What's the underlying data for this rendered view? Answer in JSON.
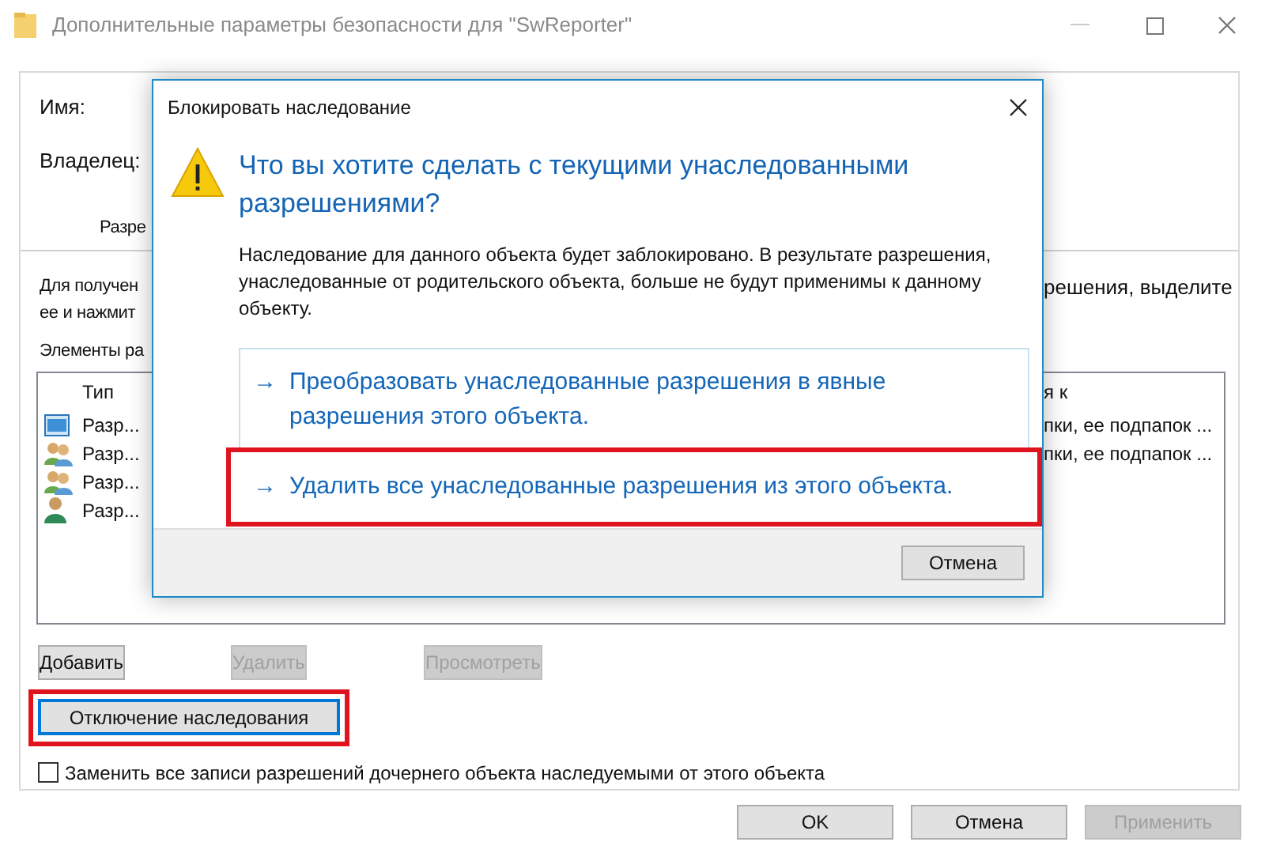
{
  "window": {
    "title": "Дополнительные параметры безопасности  для \"SwReporter\""
  },
  "fields": [
    {
      "label": "Имя:"
    },
    {
      "label": "Владелец:"
    }
  ],
  "tab": {
    "label": "Разре"
  },
  "instructions": {
    "left_lines": [
      "Для получен",
      "ее и нажмит"
    ],
    "right_lines": [
      "решения, выделите"
    ]
  },
  "entries_label": "Элементы ра",
  "table": {
    "columns": [
      {
        "label": "Тип"
      },
      {
        "label": "я к"
      }
    ],
    "rows": [
      {
        "kind": "computer",
        "type": "Разр...",
        "applies": "пки, ее подпапок ..."
      },
      {
        "kind": "group",
        "type": "Разр...",
        "applies": "пки, ее подпапок ..."
      },
      {
        "kind": "group",
        "type": "Разр..."
      },
      {
        "kind": "user",
        "type": "Разр..."
      }
    ]
  },
  "entry_buttons": [
    {
      "label": "Добавить",
      "disabled": false
    },
    {
      "label": "Удалить",
      "disabled": true
    },
    {
      "label": "Просмотреть",
      "disabled": true
    }
  ],
  "disable_inheritance": {
    "label": "Отключение наследования",
    "highlighted": true
  },
  "replace_checkbox": {
    "label": "Заменить все записи разрешений дочернего объекта наследуемыми от этого объекта",
    "checked": false
  },
  "footer_buttons": [
    {
      "label": "OK",
      "disabled": false
    },
    {
      "label": "Отмена",
      "disabled": false
    },
    {
      "label": "Применить",
      "disabled": true
    }
  ],
  "dialog": {
    "title": "Блокировать наследование",
    "question": "Что вы хотите сделать с текущими унаследованными разрешениями?",
    "description": "Наследование для данного объекта будет заблокировано. В результате разрешения, унаследованные от родительского объекта, больше не будут применимы к данному объекту.",
    "options": [
      {
        "arrow": "→",
        "label": "Преобразовать унаследованные разрешения в явные разрешения этого объекта.",
        "highlighted": false
      },
      {
        "arrow": "→",
        "label": "Удалить все унаследованные разрешения из этого объекта.",
        "highlighted": true
      }
    ],
    "cancel": "Отмена"
  }
}
